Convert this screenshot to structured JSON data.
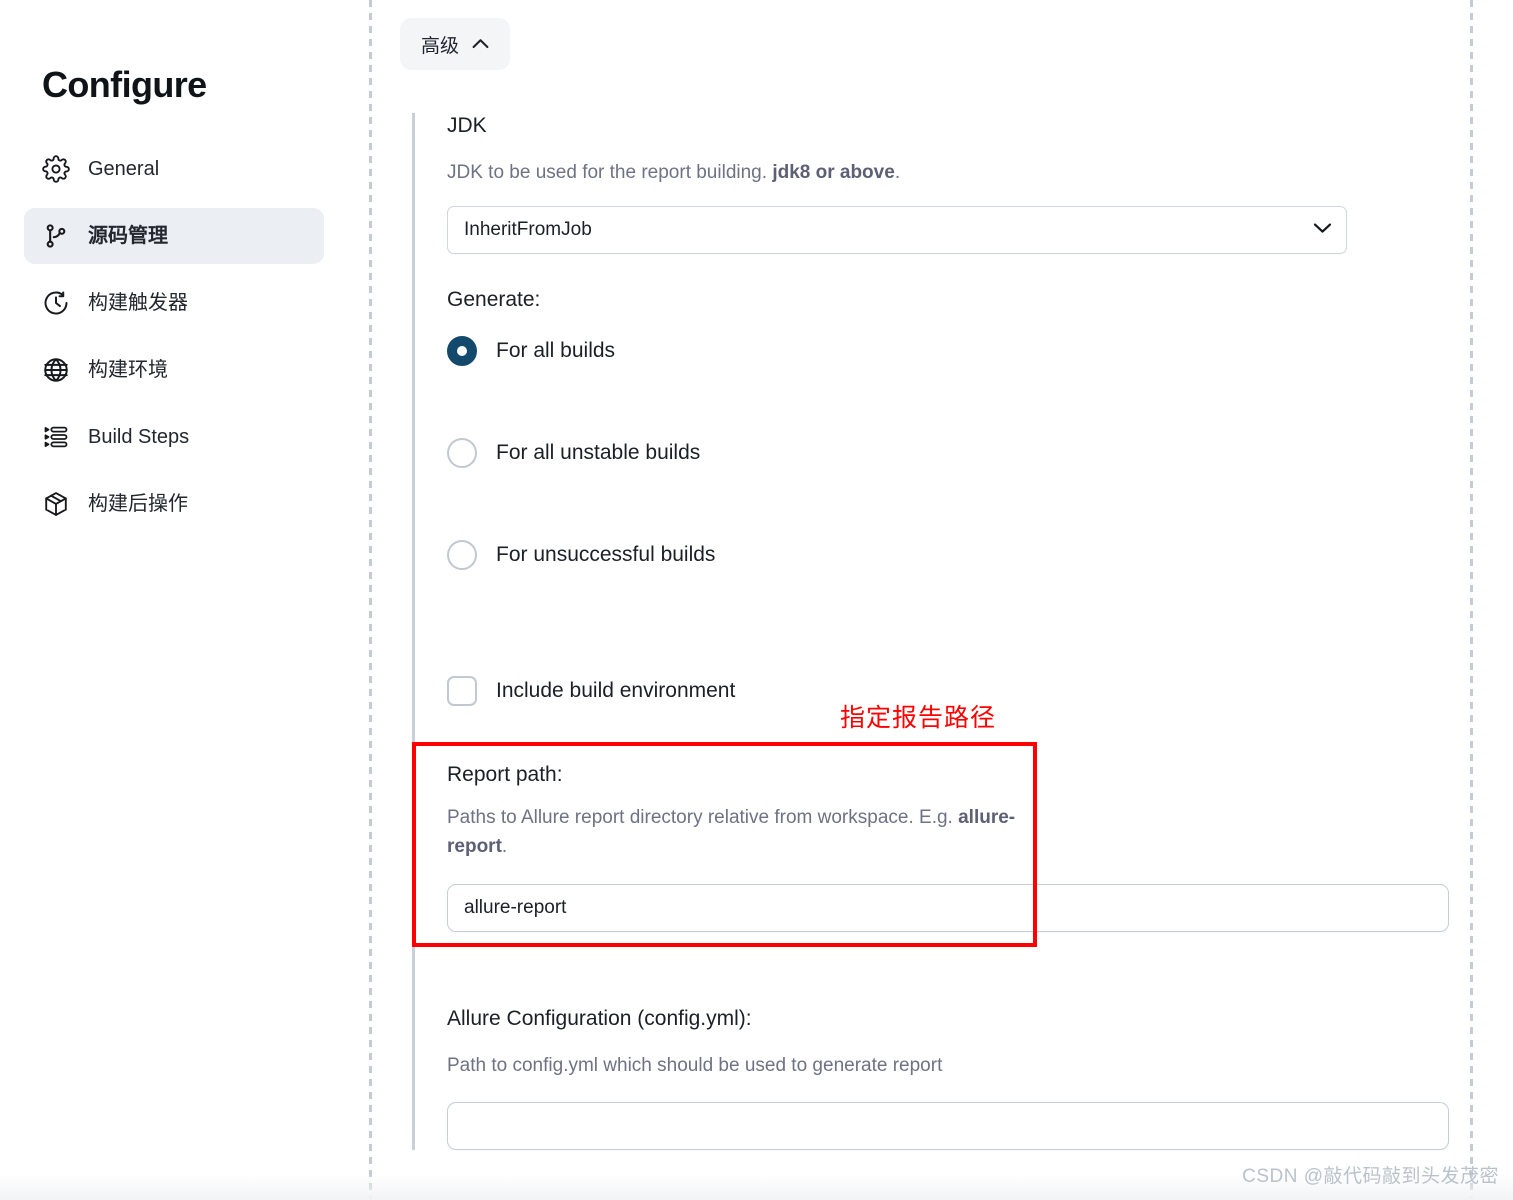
{
  "sidebar": {
    "title": "Configure",
    "items": [
      {
        "label": "General",
        "icon": "gear-icon",
        "active": false
      },
      {
        "label": "源码管理",
        "icon": "git-branch-icon",
        "active": true
      },
      {
        "label": "构建触发器",
        "icon": "clock-icon",
        "active": false
      },
      {
        "label": "构建环境",
        "icon": "globe-icon",
        "active": false
      },
      {
        "label": "Build Steps",
        "icon": "list-steps-icon",
        "active": false
      },
      {
        "label": "构建后操作",
        "icon": "package-icon",
        "active": false
      }
    ]
  },
  "toolbar": {
    "advanced_label": "高级",
    "advanced_chevron": "chevron-up-icon"
  },
  "jdk": {
    "label": "JDK",
    "desc_prefix": "JDK to be used for the report building. ",
    "desc_bold": "jdk8 or above",
    "desc_suffix": ".",
    "selected": "InheritFromJob",
    "options": [
      "InheritFromJob"
    ],
    "chevron": "chevron-down-icon"
  },
  "generate": {
    "label": "Generate:",
    "options": [
      {
        "label": "For all builds",
        "checked": true
      },
      {
        "label": "For all unstable builds",
        "checked": false
      },
      {
        "label": "For unsuccessful builds",
        "checked": false
      }
    ]
  },
  "include_build_environment": {
    "label": "Include build environment",
    "checked": false
  },
  "report_path": {
    "annotation": "指定报告路径",
    "label": "Report path:",
    "desc_prefix": "Paths to Allure report directory relative from workspace. E.g. ",
    "desc_bold": "allure-report",
    "desc_suffix": ".",
    "value": "allure-report",
    "placeholder": ""
  },
  "allure_config": {
    "label": "Allure Configuration (config.yml):",
    "desc": "Path to config.yml which should be used to generate report",
    "value": "",
    "placeholder": ""
  },
  "watermark": "CSDN @敲代码敲到头发茂密",
  "colors": {
    "accent_radio": "#14496e",
    "highlight_box": "#ff0000",
    "annotation": "#ff0000",
    "sidebar_active_bg": "#ebeef2",
    "pill_bg": "#f4f5f7",
    "rail": "#c3ccd4"
  }
}
